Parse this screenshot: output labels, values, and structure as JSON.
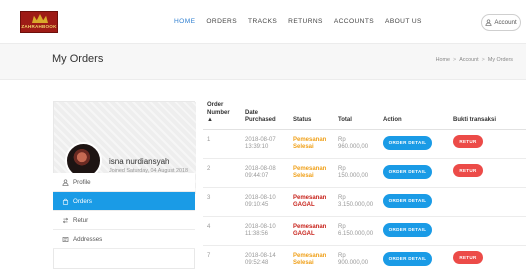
{
  "header": {
    "logo_text": "ZAHRAHBOOK",
    "nav": [
      {
        "label": "HOME"
      },
      {
        "label": "ORDERS"
      },
      {
        "label": "TRACKS"
      },
      {
        "label": "RETURNS"
      },
      {
        "label": "ACCOUNTS"
      },
      {
        "label": "ABOUT US"
      }
    ],
    "account_label": "Account",
    "active_color": "#2f7fd0"
  },
  "page": {
    "title": "My Orders",
    "breadcrumb": [
      "Home",
      "Account",
      "My Orders"
    ]
  },
  "profile": {
    "name": "isna nurdiansyah",
    "joined": "Joined Saturday, 04 August 2018"
  },
  "menu": [
    {
      "label": "Profile",
      "icon": "person-icon",
      "active": false
    },
    {
      "label": "Orders",
      "icon": "bag-icon",
      "active": true
    },
    {
      "label": "Retur",
      "icon": "retur-icon",
      "active": false
    },
    {
      "label": "Addresses",
      "icon": "addresses-icon",
      "active": false
    }
  ],
  "table": {
    "headers": {
      "order": "Order Number ▲",
      "date": "Date Purchased",
      "status": "Status",
      "total": "Total",
      "action": "Action",
      "bukti": "Bukti transaksi"
    },
    "buttons": {
      "detail": "ORDER DETAIL",
      "retur": "RETUR"
    },
    "rows": [
      {
        "no": "1",
        "date": "2018-08-07 13:39:10",
        "status": "Pemesanan Selesai",
        "state": "selesai",
        "total": "Rp 960.000,00",
        "retur": true
      },
      {
        "no": "2",
        "date": "2018-08-08 09:44:07",
        "status": "Pemesanan Selesai",
        "state": "selesai",
        "total": "Rp 150.000,00",
        "retur": true
      },
      {
        "no": "3",
        "date": "2018-08-10 09:10:45",
        "status": "Pemesanan GAGAL",
        "state": "gagal",
        "total": "Rp 3.150.000,00",
        "retur": false
      },
      {
        "no": "4",
        "date": "2018-08-10 11:38:56",
        "status": "Pemesanan GAGAL",
        "state": "gagal",
        "total": "Rp 6.150.000,00",
        "retur": false
      },
      {
        "no": "7",
        "date": "2018-08-14 09:52:48",
        "status": "Pemesanan Selesai",
        "state": "selesai",
        "total": "Rp 900.000,00",
        "retur": true
      }
    ]
  },
  "colors": {
    "primary_button": "#1a9be6",
    "retur_button": "#ec4b48",
    "status_selesai": "#f0a11b",
    "status_gagal": "#c8241c"
  }
}
